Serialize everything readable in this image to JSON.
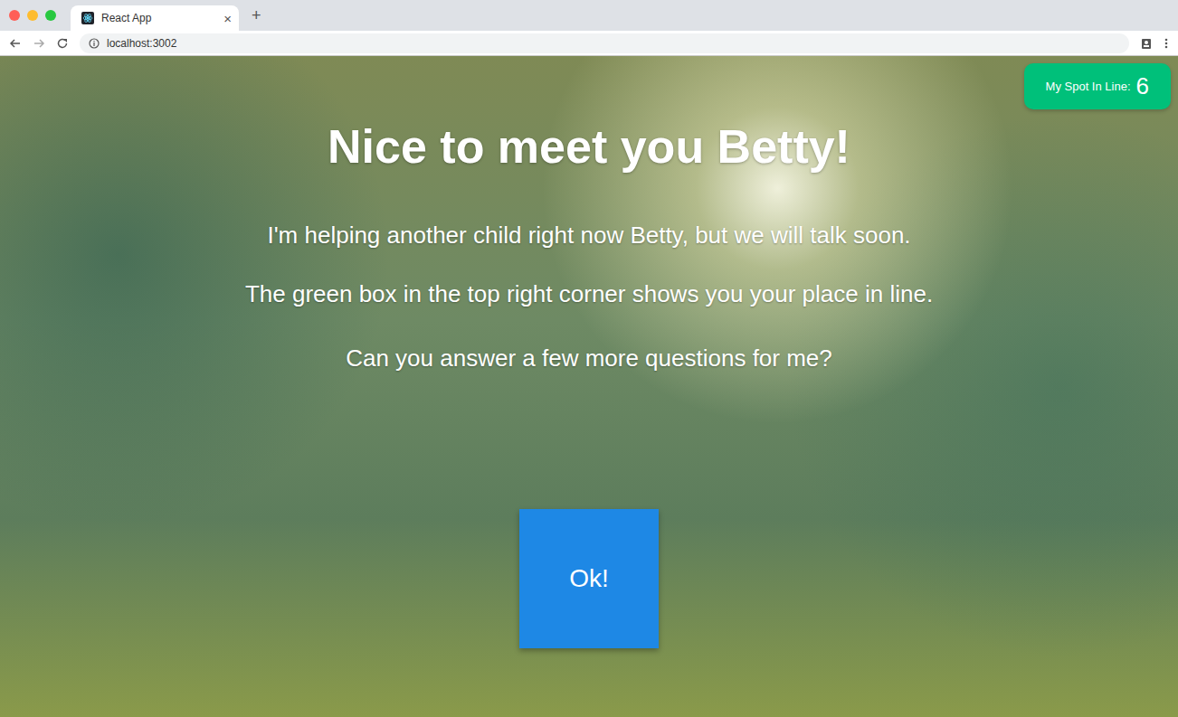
{
  "browser": {
    "tab": {
      "title": "React App",
      "close": "×",
      "selected": true
    },
    "new_tab": "+",
    "address": "localhost:3002"
  },
  "queue_badge": {
    "label": "My Spot In Line:",
    "value": "6"
  },
  "heading": "Nice to meet you Betty!",
  "paragraphs": [
    "I'm helping another child right now Betty, but we will talk soon.",
    "The green box in the top right corner shows you your place in line.",
    "Can you answer a few more questions for me?"
  ],
  "buttons": [
    "Ok!"
  ]
}
